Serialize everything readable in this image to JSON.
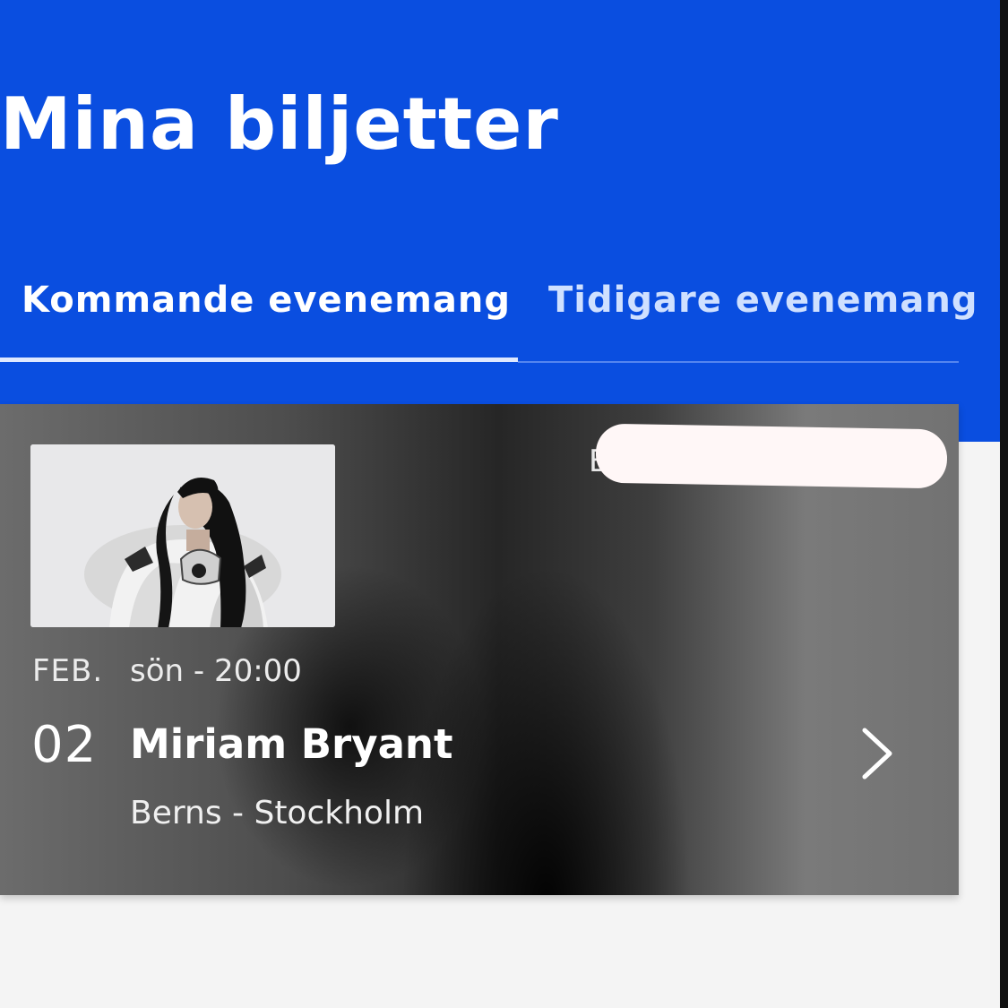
{
  "header": {
    "title": "Mina biljetter"
  },
  "tabs": [
    {
      "label": "Kommande evenemang",
      "selected": true
    },
    {
      "label": "Tidigare evenemang",
      "selected": false
    }
  ],
  "event": {
    "month": "FEB.",
    "time": "sön - 20:00",
    "day": "02",
    "title": "Miriam Bryant",
    "venue": "Berns - Stockholm",
    "partial_label": "B",
    "thumbnail_icon": "artist-photo"
  },
  "colors": {
    "header_background": "#0a4ee0",
    "page_background": "#f4f4f4",
    "text_on_header": "#ffffff"
  },
  "icons": {
    "chevron": "chevron-right-icon"
  }
}
